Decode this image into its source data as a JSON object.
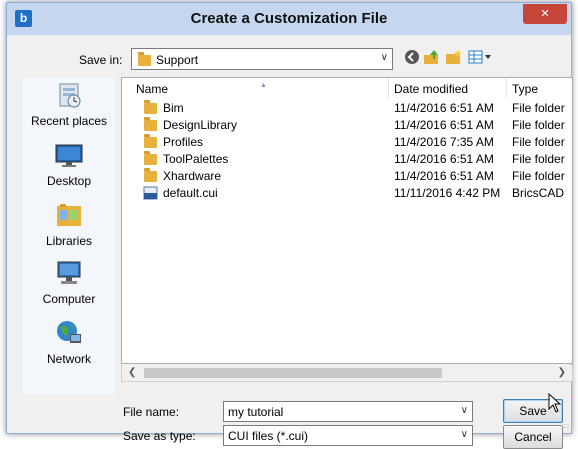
{
  "window": {
    "title": "Create a Customization File",
    "close_glyph": "×"
  },
  "save_in": {
    "label": "Save in:",
    "value": "Support"
  },
  "places": [
    {
      "label": "Recent places",
      "icon": "recent-places-icon"
    },
    {
      "label": "Desktop",
      "icon": "desktop-icon"
    },
    {
      "label": "Libraries",
      "icon": "libraries-icon"
    },
    {
      "label": "Computer",
      "icon": "computer-icon"
    },
    {
      "label": "Network",
      "icon": "network-icon"
    }
  ],
  "columns": {
    "name": "Name",
    "date": "Date modified",
    "type": "Type"
  },
  "files": [
    {
      "name": "Bim",
      "date": "11/4/2016 6:51 AM",
      "type": "File folder",
      "icon": "folder-icon"
    },
    {
      "name": "DesignLibrary",
      "date": "11/4/2016 6:51 AM",
      "type": "File folder",
      "icon": "folder-icon"
    },
    {
      "name": "Profiles",
      "date": "11/4/2016 7:35 AM",
      "type": "File folder",
      "icon": "folder-icon"
    },
    {
      "name": "ToolPalettes",
      "date": "11/4/2016 6:51 AM",
      "type": "File folder",
      "icon": "folder-icon"
    },
    {
      "name": "Xhardware",
      "date": "11/4/2016 6:51 AM",
      "type": "File folder",
      "icon": "folder-icon"
    },
    {
      "name": "default.cui",
      "date": "11/11/2016 4:42 PM",
      "type": "BricsCAD",
      "icon": "cui-file-icon"
    }
  ],
  "file_name": {
    "label": "File name:",
    "value": "my tutorial"
  },
  "save_as_type": {
    "label": "Save as type:",
    "value": "CUI files (*.cui)"
  },
  "buttons": {
    "save": "Save",
    "cancel": "Cancel"
  },
  "colors": {
    "titlebar": "#c4d7ee",
    "close": "#c7463b",
    "folder": "#e7b13e",
    "accent": "#3c7fb1"
  }
}
